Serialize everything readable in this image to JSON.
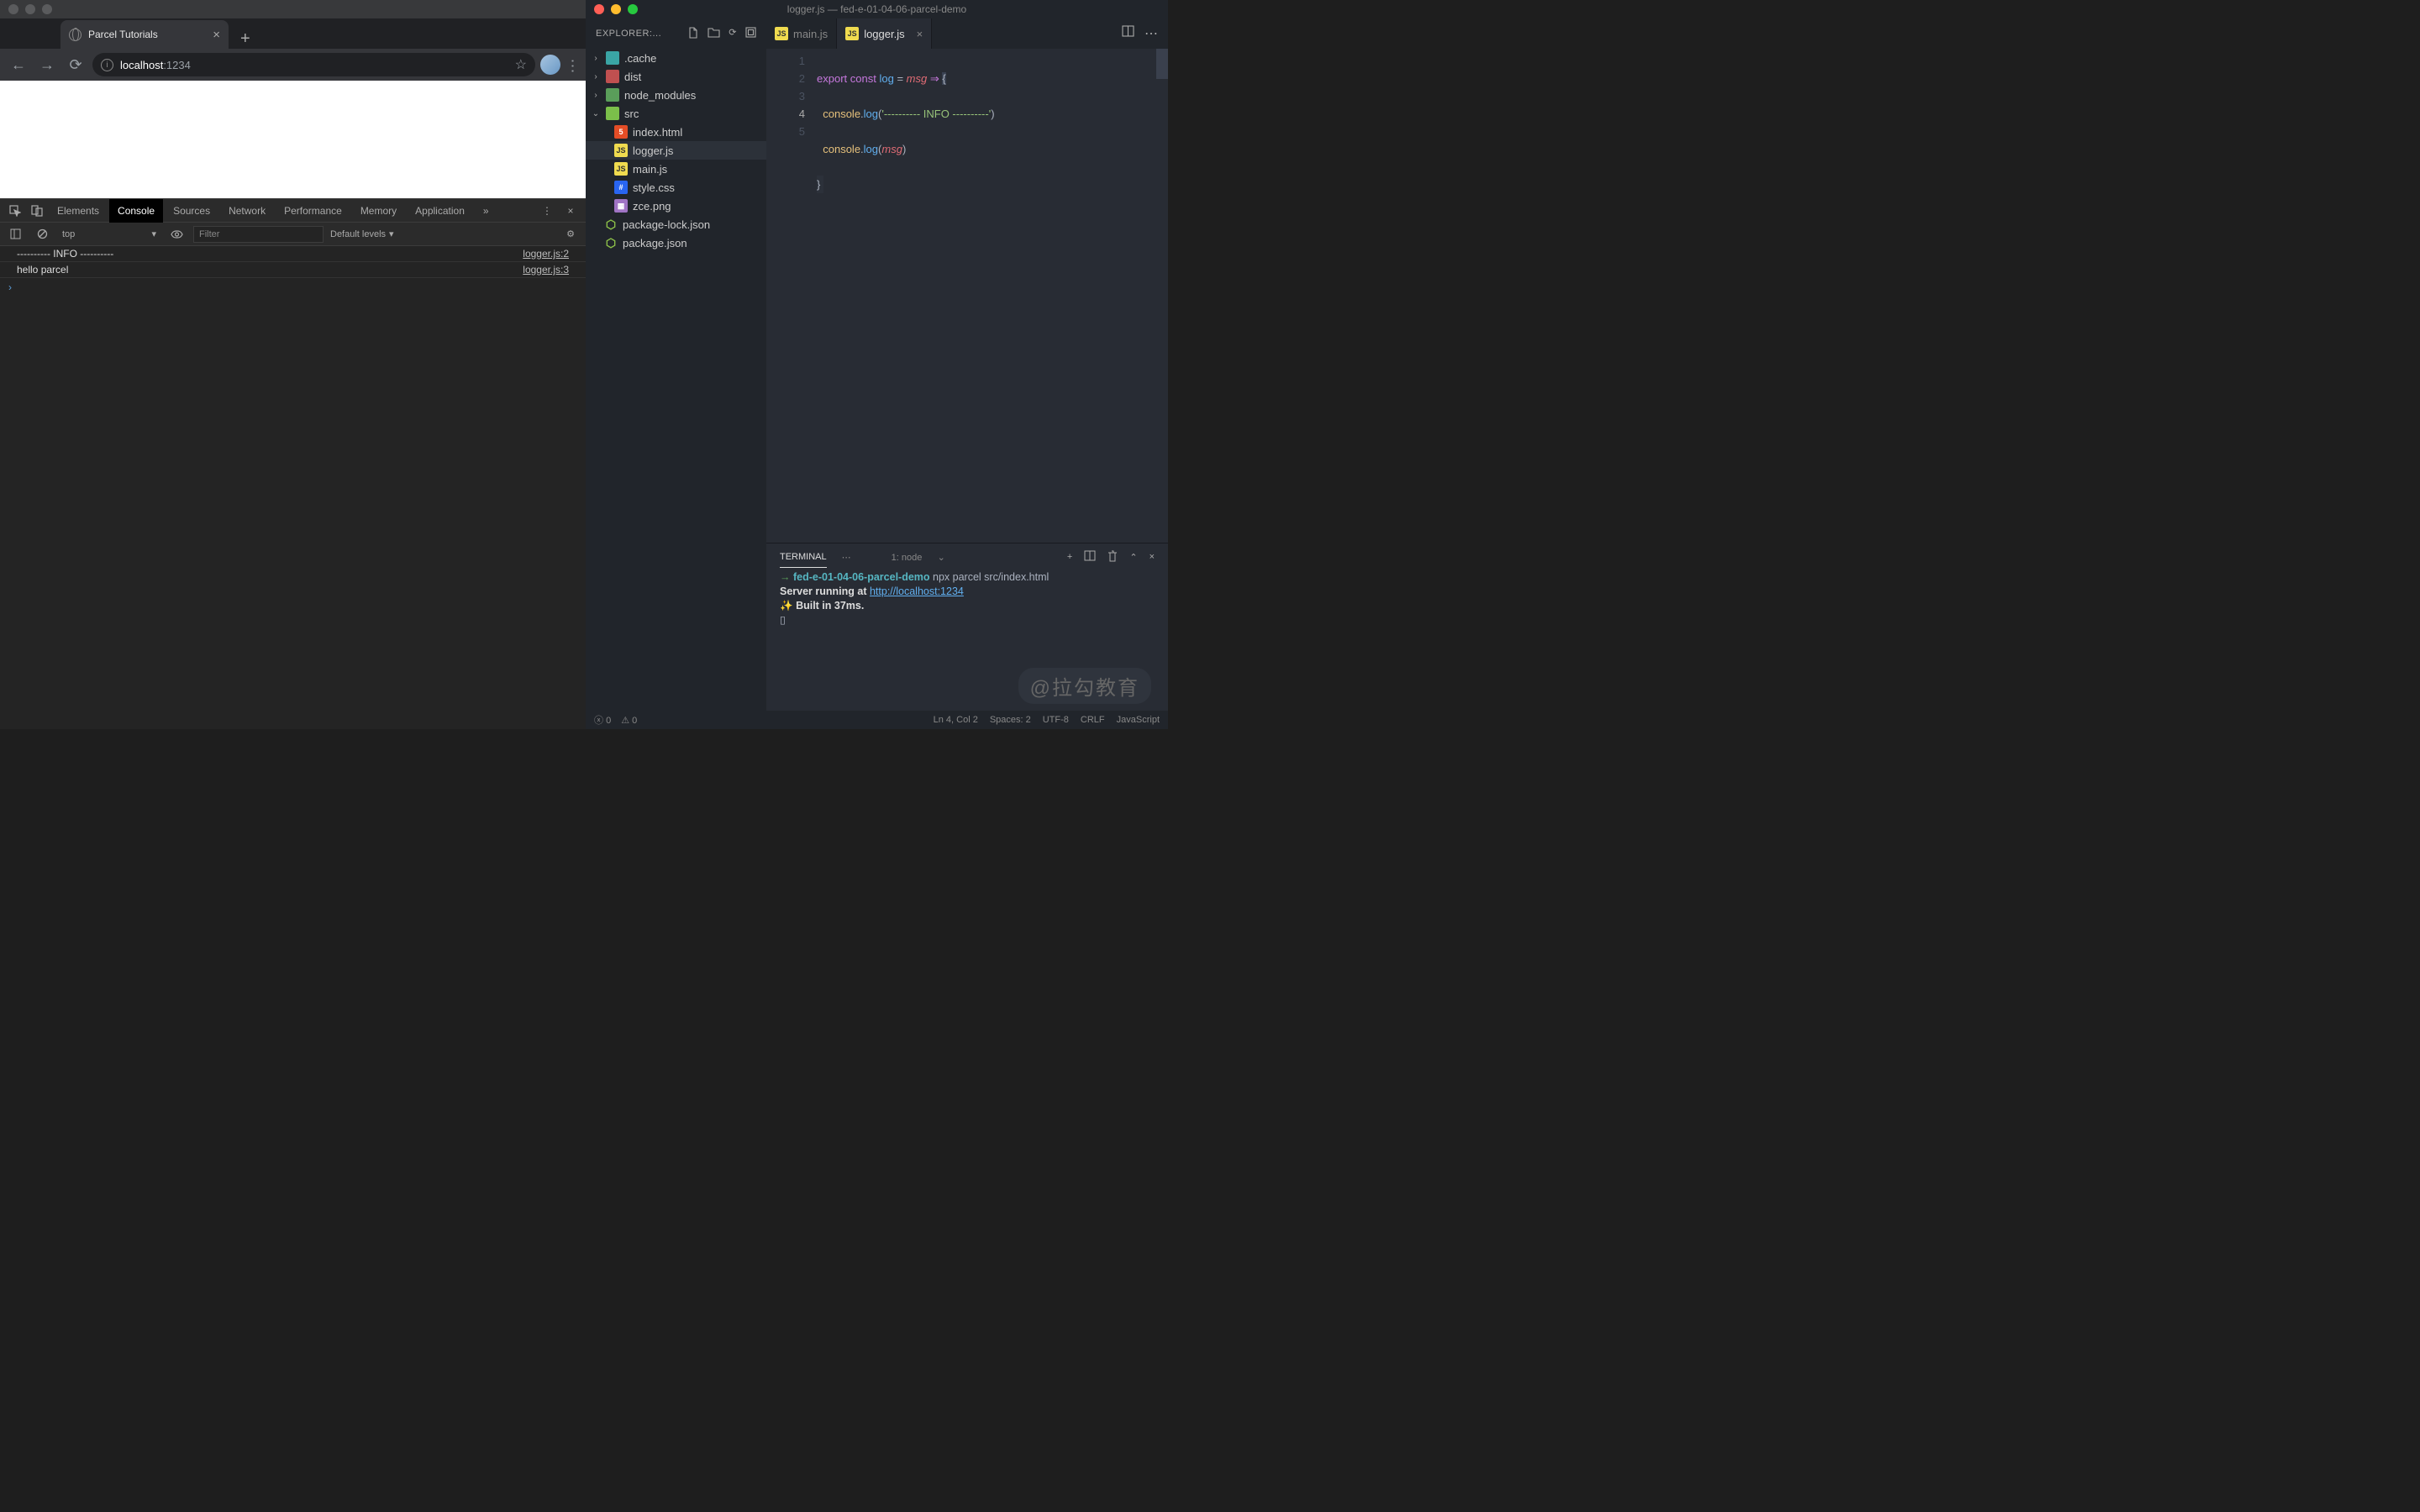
{
  "browser": {
    "tab_title": "Parcel Tutorials",
    "url_host": "localhost",
    "url_port": ":1234"
  },
  "devtools": {
    "tabs": [
      "Elements",
      "Console",
      "Sources",
      "Network",
      "Performance",
      "Memory",
      "Application"
    ],
    "context": "top",
    "filter_placeholder": "Filter",
    "levels": "Default levels",
    "logs": [
      {
        "msg": "---------- INFO ----------",
        "src": "logger.js:2"
      },
      {
        "msg": "hello parcel",
        "src": "logger.js:3"
      }
    ]
  },
  "vscode": {
    "title": "logger.js — fed-e-01-04-06-parcel-demo",
    "explorer_label": "EXPLORER:...",
    "tree": {
      "folders": [
        {
          "name": ".cache",
          "icon": "folder-teal",
          "expanded": false
        },
        {
          "name": "dist",
          "icon": "folder-red",
          "expanded": false
        },
        {
          "name": "node_modules",
          "icon": "folder-green",
          "expanded": false
        },
        {
          "name": "src",
          "icon": "folder-lime",
          "expanded": true
        }
      ],
      "src_files": [
        {
          "name": "index.html",
          "icon": "html"
        },
        {
          "name": "logger.js",
          "icon": "js",
          "selected": true
        },
        {
          "name": "main.js",
          "icon": "js"
        },
        {
          "name": "style.css",
          "icon": "css"
        },
        {
          "name": "zce.png",
          "icon": "img"
        }
      ],
      "root_files": [
        {
          "name": "package-lock.json",
          "icon": "json"
        },
        {
          "name": "package.json",
          "icon": "json"
        }
      ]
    },
    "tabs": [
      {
        "name": "main.js",
        "active": false
      },
      {
        "name": "logger.js",
        "active": true
      }
    ],
    "code": {
      "l1_export": "export",
      "l1_const": "const",
      "l1_log": "log",
      "l1_eq": " = ",
      "l1_msg": "msg",
      "l1_arrow": " ⇒ ",
      "l1_brace": "{",
      "l2_indent": "  ",
      "l2_console": "console",
      "l2_dot": ".",
      "l2_log": "log",
      "l2_p1": "(",
      "l2_str": "'---------- INFO ----------'",
      "l2_p2": ")",
      "l3_indent": "  ",
      "l3_console": "console",
      "l3_dot": ".",
      "l3_log": "log",
      "l3_p1": "(",
      "l3_msg": "msg",
      "l3_p2": ")",
      "l4": "}"
    },
    "terminal": {
      "tab": "TERMINAL",
      "select": "1: node",
      "prompt_arrow": "→",
      "cwd": "fed-e-01-04-06-parcel-demo",
      "cmd": "npx parcel src/index.html",
      "running": "Server running at ",
      "url": "http://localhost:1234",
      "built": "Built in 37ms."
    },
    "status": {
      "errors": "0",
      "warnings": "0",
      "pos": "Ln 4, Col 2",
      "spaces": "Spaces: 2",
      "enc": "UTF-8",
      "eol": "CRLF",
      "lang": "JavaScript"
    }
  },
  "watermark": "@拉勾教育"
}
